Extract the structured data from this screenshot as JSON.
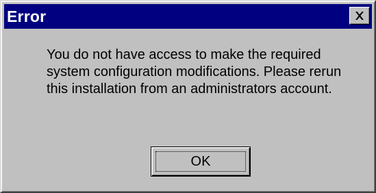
{
  "window": {
    "title": "Error",
    "close_icon": "close-x-icon"
  },
  "message": {
    "text": "You do not have access to make the required system configuration modifications. Please rerun this installation from an administrators account."
  },
  "buttons": {
    "ok_label": "OK"
  },
  "colors": {
    "titlebar": "#000080",
    "title_text": "#ffffff",
    "face": "#c0c0c0"
  }
}
